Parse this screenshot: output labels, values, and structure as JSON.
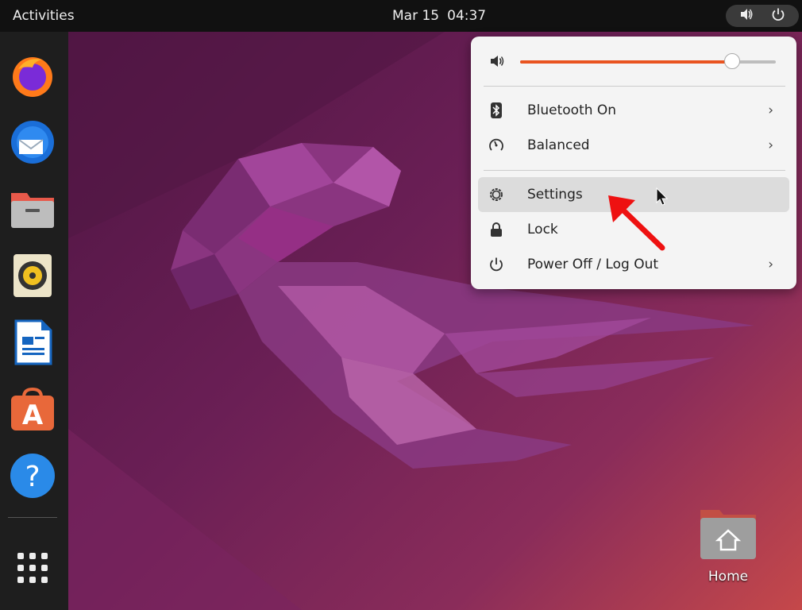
{
  "topbar": {
    "activities": "Activities",
    "date": "Mar 15",
    "time": "04:37",
    "icons": [
      "volume-icon",
      "power-icon"
    ]
  },
  "dock": {
    "apps": [
      {
        "name": "firefox",
        "icon": "firefox-icon"
      },
      {
        "name": "thunderbird",
        "icon": "thunderbird-icon"
      },
      {
        "name": "files",
        "icon": "files-icon"
      },
      {
        "name": "rhythmbox",
        "icon": "rhythmbox-icon"
      },
      {
        "name": "writer",
        "icon": "writer-icon"
      },
      {
        "name": "software",
        "icon": "software-icon"
      },
      {
        "name": "help",
        "icon": "help-icon"
      }
    ],
    "show_apps_icon": "apps-grid-icon"
  },
  "system_menu": {
    "volume_level": 0.83,
    "items": [
      {
        "label": "Bluetooth On",
        "icon": "bluetooth-icon",
        "has_submenu": true
      },
      {
        "label": "Balanced",
        "icon": "power-mode-icon",
        "has_submenu": true
      },
      {
        "label": "Settings",
        "icon": "gear-icon",
        "has_submenu": false,
        "highlighted": true
      },
      {
        "label": "Lock",
        "icon": "lock-icon",
        "has_submenu": false
      },
      {
        "label": "Power Off / Log Out",
        "icon": "power-icon",
        "has_submenu": true
      }
    ],
    "chevron": "›"
  },
  "desktop": {
    "home_label": "Home"
  },
  "colors": {
    "accent": "#e95420",
    "topbar": "#111111",
    "dock": "#1e1e1e",
    "annotation": "#ee1111"
  }
}
